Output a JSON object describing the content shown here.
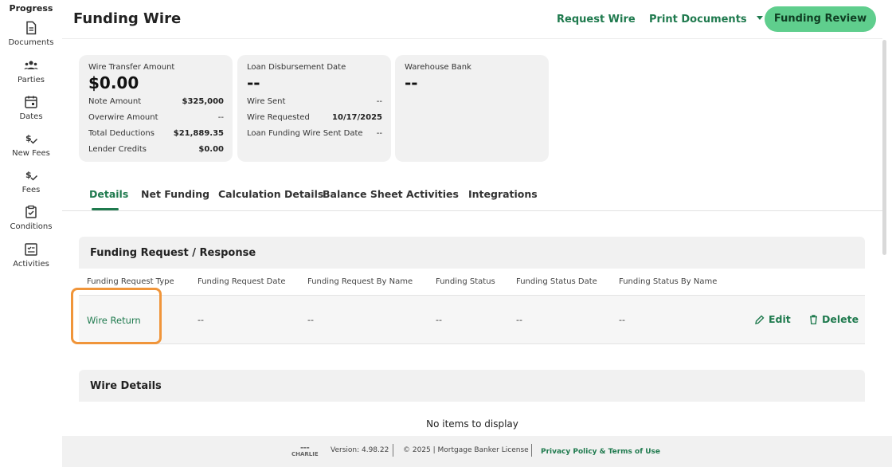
{
  "sidebar": {
    "progress_label": "Progress",
    "items": [
      {
        "label": "Documents",
        "icon": "document-icon"
      },
      {
        "label": "Parties",
        "icon": "people-icon"
      },
      {
        "label": "Dates",
        "icon": "calendar-icon"
      },
      {
        "label": "New Fees",
        "icon": "dollar-check-icon"
      },
      {
        "label": "Fees",
        "icon": "dollar-check-icon"
      },
      {
        "label": "Conditions",
        "icon": "clipboard-check-icon"
      },
      {
        "label": "Activities",
        "icon": "checklist-icon"
      }
    ]
  },
  "header": {
    "title": "Funding Wire",
    "request_wire": "Request Wire",
    "print_documents": "Print Documents",
    "funding_review": "Funding Review"
  },
  "cards": {
    "wire": {
      "label": "Wire Transfer Amount",
      "amount": "$0.00",
      "rows": [
        {
          "label": "Note Amount",
          "value": "$325,000"
        },
        {
          "label": "Overwire Amount",
          "value": "--"
        },
        {
          "label": "Total Deductions",
          "value": "$21,889.35"
        },
        {
          "label": "Lender Credits",
          "value": "$0.00"
        }
      ]
    },
    "disbursement": {
      "label": "Loan Disbursement Date",
      "amount": "--",
      "rows": [
        {
          "label": "Wire Sent",
          "value": "--"
        },
        {
          "label": "Wire Requested",
          "value": "10/17/2025"
        },
        {
          "label": "Loan Funding Wire Sent Date",
          "value": "--"
        }
      ]
    },
    "warehouse": {
      "label": "Warehouse Bank",
      "amount": "--"
    }
  },
  "tabs": [
    "Details",
    "Net Funding",
    "Calculation Details",
    "Balance Sheet",
    "Activities",
    "Integrations"
  ],
  "funding_section": {
    "title": "Funding Request / Response",
    "columns": [
      "Funding Request Type",
      "Funding Request Date",
      "Funding Request By Name",
      "Funding Status",
      "Funding Status Date",
      "Funding Status By Name"
    ],
    "row": [
      "Wire Return",
      "--",
      "--",
      "--",
      "--",
      "--"
    ],
    "edit": "Edit",
    "delete": "Delete"
  },
  "wire_section": {
    "title": "Wire Details",
    "empty": "No items to display"
  },
  "footer": {
    "logo_text": "CHARLIE",
    "version": "Version: 4.98.22",
    "copyright": "© 2025 | Mortgage Banker License",
    "privacy": "Privacy Policy & Terms of Use"
  },
  "colors": {
    "accent": "#1f7a4e",
    "button": "#5fce8d",
    "highlight": "#f0953a"
  }
}
